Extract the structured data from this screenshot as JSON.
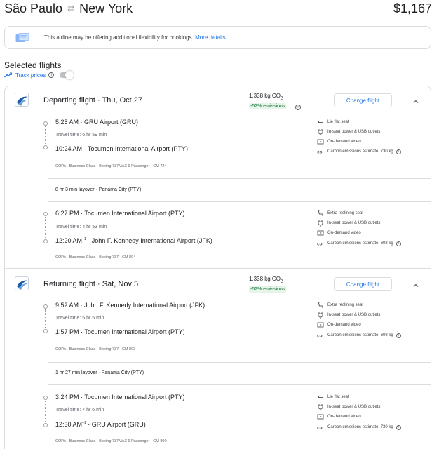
{
  "header": {
    "origin": "São Paulo",
    "destination": "New York",
    "price": "$1,167"
  },
  "banner": {
    "text": "This airline may be offering additional flexibility for bookings.",
    "link": "More details"
  },
  "selected": {
    "title": "Selected flights",
    "track_label": "Track prices",
    "track_on": false
  },
  "departing": {
    "title": "Departing flight · Thu, Oct 27",
    "co2": "1,338 kg CO",
    "co2_sub": "2",
    "emissions_badge": "-52% emissions",
    "change_button": "Change flight",
    "segments": [
      {
        "dep_time": "5:25 AM",
        "dep_airport": "GRU Airport (GRU)",
        "travel_time": "Travel time: 6 hr 59 min",
        "arr_time": "10:24 AM",
        "arr_airport": "Tocumen International Airport (PTY)",
        "details": "COPA · Business Class · Boeing 737MAX 9 Passenger · CM 724",
        "amenities": [
          {
            "icon": "lie-flat-seat-icon",
            "text": "Lie flat seat"
          },
          {
            "icon": "power-outlet-icon",
            "text": "In-seat power & USB outlets"
          },
          {
            "icon": "video-icon",
            "text": "On-demand video"
          },
          {
            "icon": "co2-icon",
            "text": "Carbon emissions estimate: 730 kg"
          }
        ]
      },
      {
        "dep_time": "6:27 PM",
        "dep_airport": "Tocumen International Airport (PTY)",
        "travel_time": "Travel time: 4 hr 53 min",
        "arr_time": "12:20 AM",
        "arr_sup": "+1",
        "arr_airport": "John F. Kennedy International Airport (JFK)",
        "details": "COPA · Business Class · Boeing 737 · CM 804",
        "amenities": [
          {
            "icon": "reclining-seat-icon",
            "text": "Extra reclining seat"
          },
          {
            "icon": "power-outlet-icon",
            "text": "In-seat power & USB outlets"
          },
          {
            "icon": "video-icon",
            "text": "On-demand video"
          },
          {
            "icon": "co2-icon",
            "text": "Carbon emissions estimate: 608 kg"
          }
        ]
      }
    ],
    "layover": "8 hr 3 min layover · Panama City (PTY)"
  },
  "returning": {
    "title": "Returning flight · Sat, Nov 5",
    "co2": "1,338 kg CO",
    "co2_sub": "2",
    "emissions_badge": "-52% emissions",
    "change_button": "Change flight",
    "segments": [
      {
        "dep_time": "9:52 AM",
        "dep_airport": "John F. Kennedy International Airport (JFK)",
        "travel_time": "Travel time: 5 hr 5 min",
        "arr_time": "1:57 PM",
        "arr_airport": "Tocumen International Airport (PTY)",
        "details": "COPA · Business Class · Boeing 737 · CM 803",
        "amenities": [
          {
            "icon": "reclining-seat-icon",
            "text": "Extra reclining seat"
          },
          {
            "icon": "power-outlet-icon",
            "text": "In-seat power & USB outlets"
          },
          {
            "icon": "video-icon",
            "text": "On-demand video"
          },
          {
            "icon": "co2-icon",
            "text": "Carbon emissions estimate: 608 kg"
          }
        ]
      },
      {
        "dep_time": "3:24 PM",
        "dep_airport": "Tocumen International Airport (PTY)",
        "travel_time": "Travel time: 7 hr 6 min",
        "arr_time": "12:30 AM",
        "arr_sup": "+1",
        "arr_airport": "GRU Airport (GRU)",
        "details": "COPA · Business Class · Boeing 737MAX 9 Passenger · CM 800",
        "amenities": [
          {
            "icon": "lie-flat-seat-icon",
            "text": "Lie flat seat"
          },
          {
            "icon": "power-outlet-icon",
            "text": "In-seat power & USB outlets"
          },
          {
            "icon": "video-icon",
            "text": "On-demand video"
          },
          {
            "icon": "co2-icon",
            "text": "Carbon emissions estimate: 730 kg"
          }
        ]
      }
    ],
    "layover": "1 hr 27 min layover · Panama City (PTY)"
  },
  "colors": {
    "accent": "#1a73e8",
    "emissions_bg": "#e6f4ea",
    "emissions_text": "#137333",
    "border": "#dadce0"
  }
}
